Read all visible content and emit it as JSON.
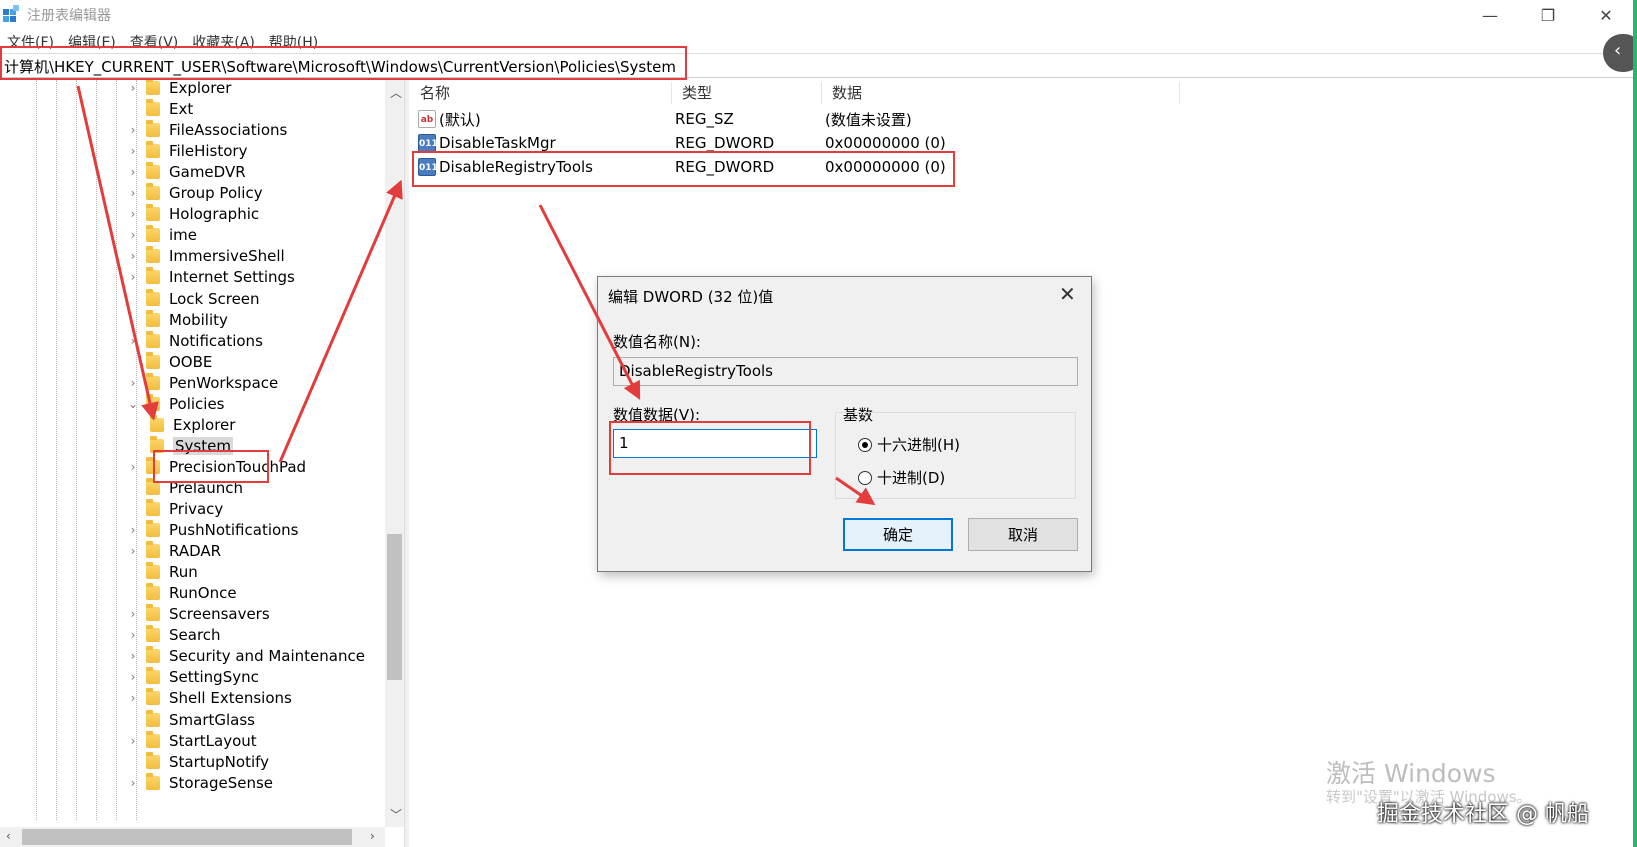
{
  "window": {
    "title": "注册表编辑器",
    "controls": {
      "minimize": "—",
      "maximize": "❐",
      "close": "✕"
    }
  },
  "menu": [
    "文件(F)",
    "编辑(E)",
    "查看(V)",
    "收藏夹(A)",
    "帮助(H)"
  ],
  "address": "计算机\\HKEY_CURRENT_USER\\Software\\Microsoft\\Windows\\CurrentVersion\\Policies\\System",
  "tree": [
    {
      "label": "Explorer",
      "expander": "›"
    },
    {
      "label": "Ext",
      "expander": ""
    },
    {
      "label": "FileAssociations",
      "expander": "›"
    },
    {
      "label": "FileHistory",
      "expander": "›"
    },
    {
      "label": "GameDVR",
      "expander": "›"
    },
    {
      "label": "Group Policy",
      "expander": "›"
    },
    {
      "label": "Holographic",
      "expander": "›"
    },
    {
      "label": "ime",
      "expander": "›"
    },
    {
      "label": "ImmersiveShell",
      "expander": "›"
    },
    {
      "label": "Internet Settings",
      "expander": "›"
    },
    {
      "label": "Lock Screen",
      "expander": ""
    },
    {
      "label": "Mobility",
      "expander": ""
    },
    {
      "label": "Notifications",
      "expander": "›"
    },
    {
      "label": "OOBE",
      "expander": ""
    },
    {
      "label": "PenWorkspace",
      "expander": "›"
    },
    {
      "label": "Policies",
      "expander": "⌄"
    },
    {
      "label": "Explorer",
      "expander": "",
      "child": true
    },
    {
      "label": "System",
      "expander": "",
      "child": true,
      "selected": true
    },
    {
      "label": "PrecisionTouchPad",
      "expander": "›"
    },
    {
      "label": "Prelaunch",
      "expander": ""
    },
    {
      "label": "Privacy",
      "expander": ""
    },
    {
      "label": "PushNotifications",
      "expander": "›"
    },
    {
      "label": "RADAR",
      "expander": "›"
    },
    {
      "label": "Run",
      "expander": ""
    },
    {
      "label": "RunOnce",
      "expander": ""
    },
    {
      "label": "Screensavers",
      "expander": "›"
    },
    {
      "label": "Search",
      "expander": "›"
    },
    {
      "label": "Security and Maintenance",
      "expander": "›"
    },
    {
      "label": "SettingSync",
      "expander": "›"
    },
    {
      "label": "Shell Extensions",
      "expander": "›"
    },
    {
      "label": "SmartGlass",
      "expander": ""
    },
    {
      "label": "StartLayout",
      "expander": "›"
    },
    {
      "label": "StartupNotify",
      "expander": ""
    },
    {
      "label": "StorageSense",
      "expander": "›"
    }
  ],
  "columns": {
    "name": "名称",
    "type": "类型",
    "data": "数据"
  },
  "values": [
    {
      "icon": "ab",
      "name": "(默认)",
      "type": "REG_SZ",
      "data": "(数值未设置)"
    },
    {
      "icon": "bin",
      "name": "DisableTaskMgr",
      "type": "REG_DWORD",
      "data": "0x00000000 (0)"
    },
    {
      "icon": "bin",
      "name": "DisableRegistryTools",
      "type": "REG_DWORD",
      "data": "0x00000000 (0)"
    }
  ],
  "dialog": {
    "title": "编辑 DWORD (32 位)值",
    "name_label": "数值名称(N):",
    "name_value": "DisableRegistryTools",
    "data_label": "数值数据(V):",
    "data_value": "1",
    "base_label": "基数",
    "hex_label": "十六进制(H)",
    "dec_label": "十进制(D)",
    "selected_base": "hex",
    "ok_label": "确定",
    "cancel_label": "取消"
  },
  "watermark": {
    "activate_title": "激活 Windows",
    "activate_sub": "转到\"设置\"以激活 Windows。",
    "credit": "掘金技术社区 @ 帆船"
  },
  "colors": {
    "annotation_red": "#e23c3c",
    "accent_blue": "#0078d7",
    "folder_yellow": "#f2bd3e"
  }
}
